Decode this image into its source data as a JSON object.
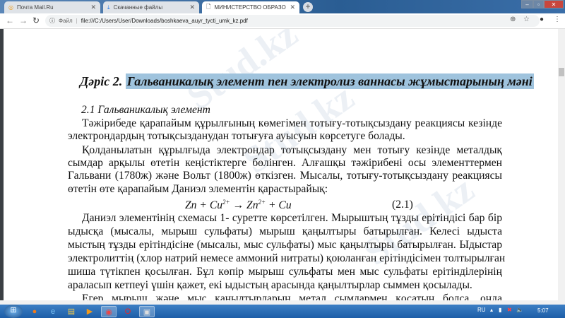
{
  "browser": {
    "tabs": [
      {
        "label": "Почта Mail.Ru",
        "icon": "mail-icon"
      },
      {
        "label": "Скачанные файлы",
        "icon": "download-icon"
      },
      {
        "label": "МИНИСТЕРСТВО ОБРАЗОВАНИ",
        "icon": "document-icon"
      }
    ],
    "address_prefix": "Файл",
    "url": "file:///C:/Users/User/Downloads/boshkaeva_auyr_tycti_umk_kz.pdf"
  },
  "document": {
    "heading_prefix": "Дәріс 2.",
    "heading_highlight": "Гальваникалық элемент пен электролиз ваннасы жұмыстарының мәні",
    "subheading": "2.1 Гальваникалық элемент",
    "lines": [
      "Тәжірибеде қарапайым құрылғының көмегімен тотығу-тотықсыздану реакциясы кезінде",
      "электрондардың тотықсызданудан тотығуға ауысуын көрсетуге болады.",
      "Қолданылатын құрылғыда электрондар тотықсыздану мен тотығу кезінде металдық",
      "сымдар арқылы өтетін кеңістіктерге бөлінген. Алғашқы тәжірибені осы элементтермен",
      "Гальвани (1780ж) және Вольт (1800ж) өткізген. Мысалы, тотығу-тотықсыздану реакциясы",
      "өтетін өте қарапайым Даниэл элементін қарастырайық:",
      "Даниэл элементінің схемасы 1- суретте көрсетілген. Мырыштың тұзды ерітіндісі бар бір",
      "ыдысқа  (мысалы, мырыш сульфаты) мырыш қаңылтыры батырылған. Келесі ыдыста",
      "мыстың тұзды ерітіндісіне (мысалы, мыс сульфаты) мыс қаңылтыры батырылған. Ыдыстар",
      "электролиттің (хлор натрий немесе аммоний нитраты) қоюланған ерітіндісімен толтырылған",
      "шиша түтікпен қосылған. Бұл көпір мырыш сульфаты мен мыс сульфаты ерітінділерінің",
      "араласып кетпеуі үшін қажет, екі ыдыстың арасында қаңылтырлар сыммен қосылады.",
      "Егер мырыш және мыс қаңылтырларын метал сымдармен қосатын болса, онда"
    ],
    "formula": {
      "a": "Zn",
      "b": "Cu",
      "sup1": "2+",
      "arrow": "→",
      "c": "Zn",
      "sup2": "2+",
      "d": "Cu",
      "plus": "+",
      "number": "(2.1)"
    },
    "watermark": "Stud.kz"
  },
  "taskbar": {
    "lang": "RU",
    "time": "5:07"
  },
  "colors": {
    "highlight": "#9fc3dd",
    "tabbar": "#2a5d93"
  }
}
